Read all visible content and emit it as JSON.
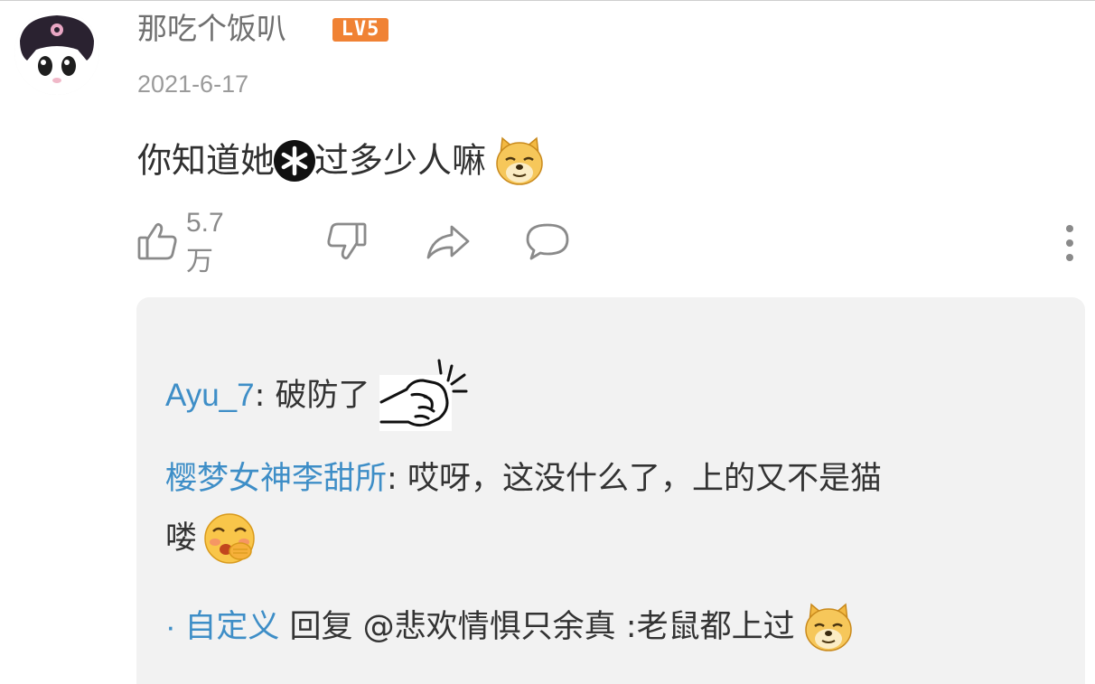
{
  "comment": {
    "username": "那吃个饭叭",
    "level_badge": "LV5",
    "date": "2021-6-17",
    "text_before": "你知道她",
    "text_after": "过多少人嘛",
    "censor_icon": "asterisk-censor-icon",
    "emoji": "doge-emoji-icon"
  },
  "actions": {
    "like_icon": "thumbs-up-icon",
    "like_count": "5.7万",
    "dislike_icon": "thumbs-down-icon",
    "share_icon": "share-arrow-icon",
    "reply_icon": "comment-bubble-icon",
    "more_icon": "vertical-ellipsis-icon"
  },
  "replies": [
    {
      "name": "Ayu_7",
      "colon": ": ",
      "body": "破防了",
      "emoji": "punch-fist-emoji-icon"
    },
    {
      "name": "樱梦女神李甜所",
      "colon": ": ",
      "body_line1": "哎呀，这没什么了，上的又不是猫",
      "body_line2": "喽",
      "emoji": "blushing-covered-mouth-emoji-icon"
    },
    {
      "bullet": "· ",
      "name": "自定义",
      "body": " 回复 @悲欢情惧只余真 :老鼠都上过",
      "emoji": "doge-emoji-icon"
    }
  ],
  "colors": {
    "username_link": "#3e8ec7",
    "badge": "#f08234",
    "reply_background": "#f2f2f2"
  }
}
